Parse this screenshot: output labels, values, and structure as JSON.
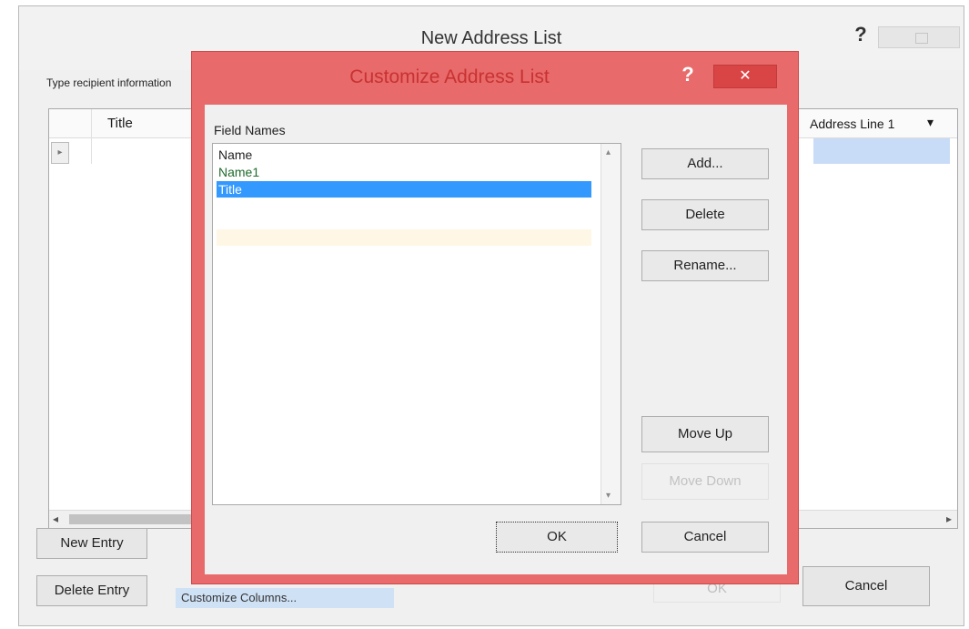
{
  "outer_dialog": {
    "title": "New Address List",
    "help_glyph": "?",
    "instruction": "Type recipient information",
    "columns": {
      "title": "Title",
      "address_line_1": "Address Line 1"
    },
    "dropdown_glyph": "▾",
    "row_selector": "▸",
    "scroll_left": "◂",
    "scroll_right": "▸",
    "buttons": {
      "new_entry": "New Entry",
      "delete_entry": "Delete Entry",
      "ok": "OK",
      "cancel": "Cancel"
    },
    "customize_columns": "Customize Columns..."
  },
  "inner_dialog": {
    "title": "Customize Address List",
    "help_glyph": "?",
    "close_glyph": "✕",
    "field_names_label": "Field Names",
    "field_names": [
      "Name",
      "Name1",
      "Title"
    ],
    "selected_index": 2,
    "scroll_up": "▴",
    "scroll_down": "▾",
    "buttons": {
      "add": "Add...",
      "delete": "Delete",
      "rename": "Rename...",
      "move_up": "Move Up",
      "move_down": "Move Down",
      "ok": "OK",
      "cancel": "Cancel"
    }
  }
}
